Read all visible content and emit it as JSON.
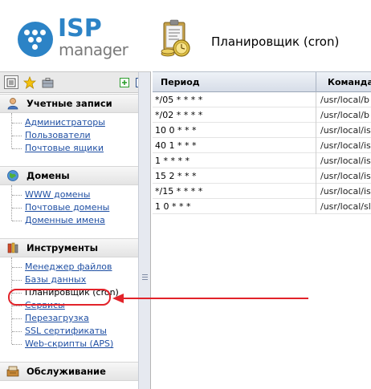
{
  "header": {
    "logo_isp": "ISP",
    "logo_manager": "manager",
    "page_title": "Планировщик (cron)",
    "icons": {
      "logo": "ispmanager-logo-icon",
      "module": "scheduler-clipboard-icon"
    }
  },
  "sidebar": {
    "toolbar": {
      "icons": [
        "tree-view-icon",
        "star-favorites-icon",
        "briefcase-icon",
        "expand-all-icon",
        "collapse-all-icon"
      ],
      "expand_symbol": "+",
      "collapse_symbol": "−"
    },
    "groups": [
      {
        "title": "Учетные записи",
        "icon": "accounts-icon",
        "items": [
          "Администраторы",
          "Пользователи",
          "Почтовые ящики"
        ]
      },
      {
        "title": "Домены",
        "icon": "domains-globe-icon",
        "items": [
          "WWW домены",
          "Почтовые домены",
          "Доменные имена"
        ]
      },
      {
        "title": "Инструменты",
        "icon": "tools-icon",
        "items": [
          "Менеджер файлов",
          "Базы данных",
          "Планировщик (cron)",
          "Сервисы",
          "Перезагрузка",
          "SSL сертификаты",
          "Web-скрипты (APS)"
        ]
      },
      {
        "title": "Обслуживание",
        "icon": "maintenance-icon",
        "items": []
      }
    ]
  },
  "table": {
    "columns": [
      "Период",
      "Команда"
    ],
    "rows": [
      [
        "*/05 * * * *",
        "/usr/local/b"
      ],
      [
        "*/02 * * * *",
        "/usr/local/b"
      ],
      [
        "10 0 * * *",
        "/usr/local/is"
      ],
      [
        "40 1 * * *",
        "/usr/local/is"
      ],
      [
        "1 * * * *",
        "/usr/local/is"
      ],
      [
        "15 2 * * *",
        "/usr/local/is"
      ],
      [
        "*/15 * * * *",
        "/usr/local/is"
      ],
      [
        "1 0 * * *",
        "/usr/local/sl"
      ]
    ]
  },
  "colors": {
    "brand_blue": "#2c83c6",
    "link_blue": "#1f4fa3",
    "annotation_red": "#e2232a",
    "toolbar_green": "#2e9e2e"
  }
}
